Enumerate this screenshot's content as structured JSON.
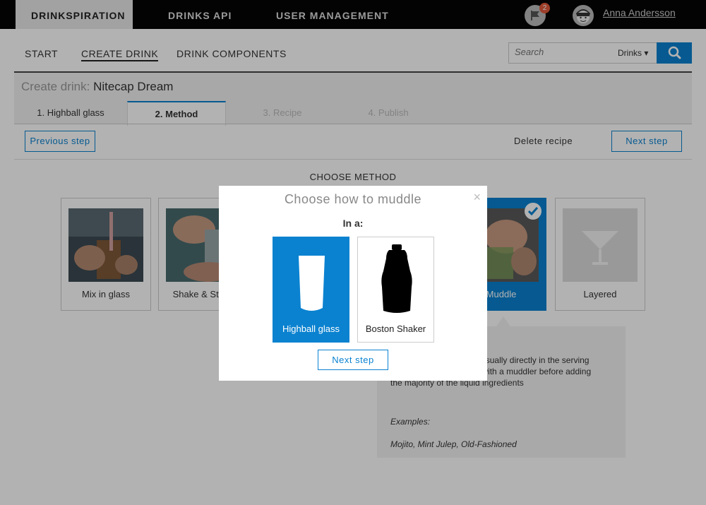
{
  "topnav": {
    "brand": "DRINKSPIRATION",
    "api": "DRINKS API",
    "users": "USER MANAGEMENT",
    "notification_count": "2",
    "username": "Anna Andersson"
  },
  "subnav": {
    "start": "START",
    "create": "CREATE DRINK",
    "components": "DRINK COMPONENTS",
    "search_placeholder": "Search",
    "search_scope": "Drinks ▾"
  },
  "create": {
    "label": "Create drink:",
    "name": "Nitecap Dream",
    "steps": [
      "1. Highball glass",
      "2. Method",
      "3. Recipe",
      "4. Publish"
    ],
    "prev_btn": "Previous step",
    "delete_link": "Delete recipe",
    "next_btn": "Next step"
  },
  "methods": {
    "heading": "CHOOSE METHOD",
    "cards": [
      "Mix in glass",
      "Shake & Strain",
      "Muddle",
      "Layered"
    ],
    "selected": "Muddle"
  },
  "info": {
    "desc": "Muddle the ingredients, usually directly in the serving glass, by pressing them with a muddler before adding the majority of the liquid ingredients",
    "desc_visible": "…he ingredients, usually …ng glass, by pressing them with a muddler before adding the majority of the liquid ingredients",
    "examples_label": "Examples:",
    "examples": "Mojito, Mint Julep, Old-Fashioned"
  },
  "modal": {
    "title": "Choose how to muddle",
    "close": "×",
    "subtitle": "In a:",
    "options": [
      "Highball glass",
      "Boston Shaker"
    ],
    "selected": "Highball glass",
    "next_btn": "Next step"
  },
  "colors": {
    "accent": "#0a82d0",
    "topbar": "#050505",
    "badge": "#e05a3c"
  }
}
